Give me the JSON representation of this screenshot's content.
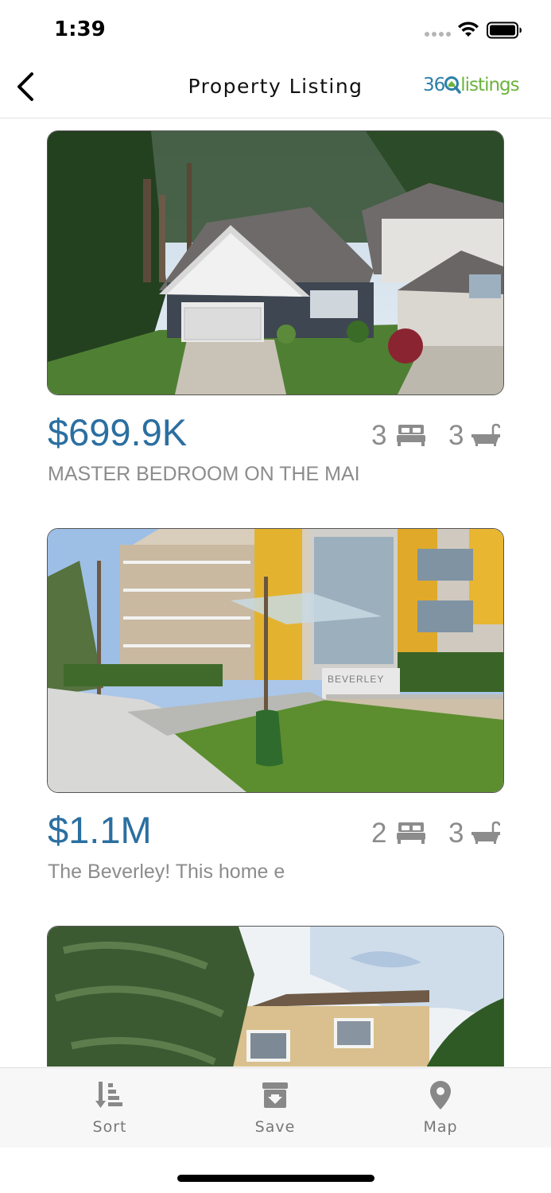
{
  "status_bar": {
    "time": "1:39"
  },
  "nav": {
    "title": "Property Listing",
    "brand_prefix": "36",
    "brand_suffix": "listings",
    "back_icon": "chevron-left-icon"
  },
  "listings": [
    {
      "price": "$699.9K",
      "beds": "3",
      "baths": "3",
      "description": "MASTER BEDROOM ON THE MAI",
      "photo": "two-storey-house-with-garage-in-forest"
    },
    {
      "price": "$1.1M",
      "beds": "2",
      "baths": "3",
      "description": "The Beverley! This home e",
      "photo": "condo-building-the-beverley",
      "sign_text": "BEVERLEY"
    },
    {
      "price": "",
      "beds": "",
      "baths": "",
      "description": "",
      "photo": "beige-house-with-monkey-puzzle-tree"
    }
  ],
  "tabs": [
    {
      "label": "Sort",
      "icon": "sort-icon"
    },
    {
      "label": "Save",
      "icon": "archive-box-icon"
    },
    {
      "label": "Map",
      "icon": "map-pin-icon"
    }
  ],
  "colors": {
    "price": "#2b6fa0",
    "muted_text": "#8c8c8c",
    "brand_blue": "#2e7fa8",
    "brand_green": "#6bb43c",
    "tab_bar_bg": "#f7f7f7"
  }
}
